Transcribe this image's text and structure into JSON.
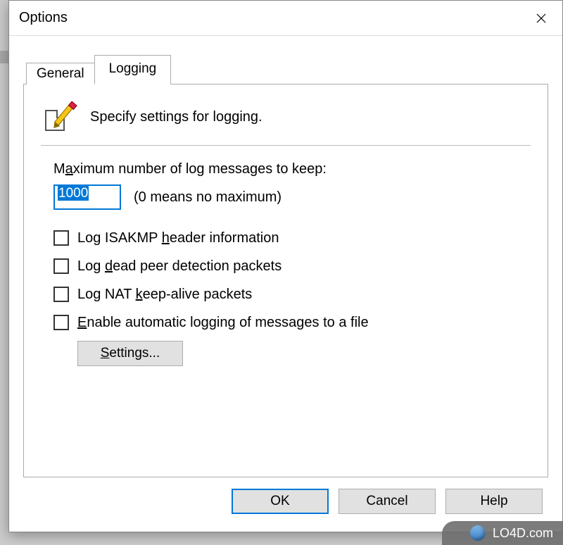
{
  "window": {
    "title": "Options"
  },
  "tabs": {
    "general": "General",
    "logging": "Logging",
    "active": "logging"
  },
  "panel": {
    "description": "Specify settings for logging."
  },
  "max_messages": {
    "label_pre": "M",
    "label_ul": "a",
    "label_post": "ximum number of log messages to keep:",
    "value": "1000",
    "hint": "(0 means no maximum)"
  },
  "checks": [
    {
      "pre": "Log ISAKMP ",
      "ul": "h",
      "post": "eader information",
      "checked": false
    },
    {
      "pre": "Log ",
      "ul": "d",
      "post": "ead peer detection packets",
      "checked": false
    },
    {
      "pre": "Log NAT ",
      "ul": "k",
      "post": "eep-alive packets",
      "checked": false
    },
    {
      "pre": "",
      "ul": "E",
      "post": "nable automatic logging of messages to a file",
      "checked": false
    }
  ],
  "settings_btn": {
    "ul": "S",
    "post": "ettings..."
  },
  "buttons": {
    "ok": "OK",
    "cancel": "Cancel",
    "help": "Help"
  },
  "watermark": "LO4D.com"
}
